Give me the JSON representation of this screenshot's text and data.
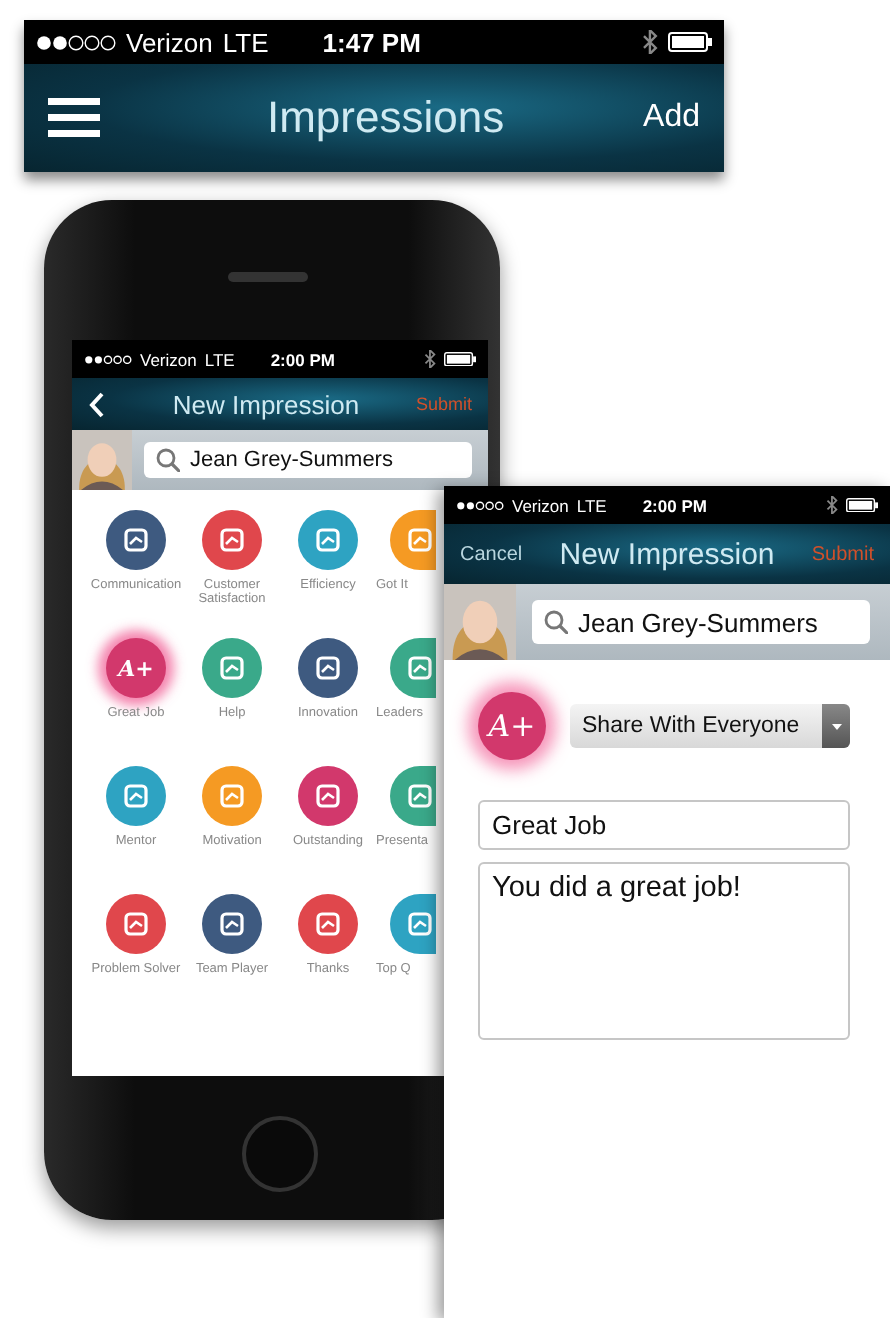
{
  "main_screen": {
    "status_bar": {
      "carrier": "Verizon",
      "network": "LTE",
      "time": "1:47 PM"
    },
    "nav_bar": {
      "left": {
        "kind": "menu"
      },
      "title": "Impressions",
      "right": {
        "label": "Add",
        "kind": "plain"
      }
    }
  },
  "phone_screen": {
    "status_bar": {
      "carrier": "Verizon",
      "network": "LTE",
      "time": "2:00 PM"
    },
    "nav_bar": {
      "left": {
        "kind": "back"
      },
      "title": "New Impression",
      "right": {
        "label": "Submit",
        "kind": "primary"
      }
    },
    "search": {
      "value": "Jean Grey-Summers"
    },
    "icons": [
      {
        "label": "Communication",
        "color": "#3e5a80",
        "selected": false
      },
      {
        "label": "Customer Satisfaction",
        "color": "#e0474c",
        "selected": false
      },
      {
        "label": "Efficiency",
        "color": "#2ea3c2",
        "selected": false
      },
      {
        "label": "Got It",
        "color": "#f59a23",
        "selected": false
      },
      {
        "label": "Great Job",
        "color": "#d2386c",
        "selected": true,
        "glyph": "A+"
      },
      {
        "label": "Help",
        "color": "#3aa98a",
        "selected": false
      },
      {
        "label": "Innovation",
        "color": "#3e5a80",
        "selected": false
      },
      {
        "label": "Leaders",
        "color": "#3aa98a",
        "selected": false
      },
      {
        "label": "Mentor",
        "color": "#2ea3c2",
        "selected": false
      },
      {
        "label": "Motivation",
        "color": "#f59a23",
        "selected": false
      },
      {
        "label": "Outstanding",
        "color": "#d2386c",
        "selected": false
      },
      {
        "label": "Presenta",
        "color": "#3aa98a",
        "selected": false
      },
      {
        "label": "Problem Solver",
        "color": "#e0474c",
        "selected": false
      },
      {
        "label": "Team Player",
        "color": "#3e5a80",
        "selected": false
      },
      {
        "label": "Thanks",
        "color": "#e0474c",
        "selected": false
      },
      {
        "label": "Top Q",
        "color": "#2ea3c2",
        "selected": false
      }
    ]
  },
  "compose_screen": {
    "status_bar": {
      "carrier": "Verizon",
      "network": "LTE",
      "time": "2:00 PM"
    },
    "nav_bar": {
      "left": {
        "kind": "text",
        "label": "Cancel"
      },
      "title": "New Impression",
      "right": {
        "label": "Submit",
        "kind": "primary"
      }
    },
    "search": {
      "value": "Jean Grey-Summers"
    },
    "badge": "A+",
    "share": "Share With Everyone",
    "subject": "Great Job",
    "message": "You did a great job!"
  }
}
